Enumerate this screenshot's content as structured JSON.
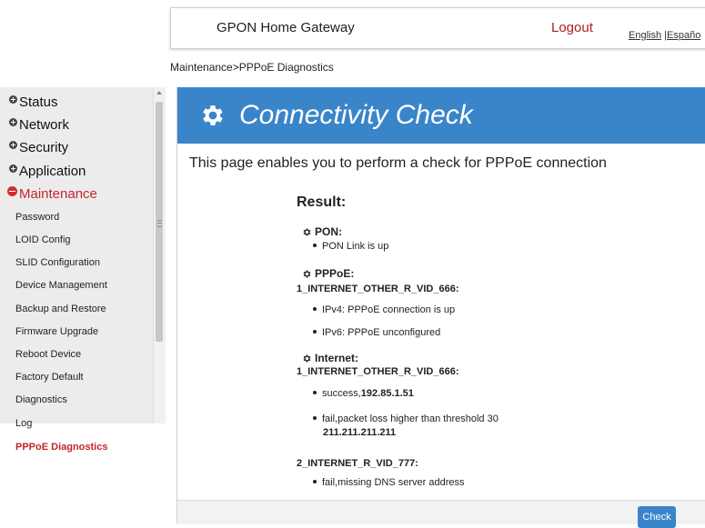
{
  "header": {
    "title": "GPON Home Gateway",
    "logout": "Logout",
    "lang_english": "English",
    "lang_sep": " |",
    "lang_spanish": "Españo"
  },
  "breadcrumb": "Maintenance>PPPoE Diagnostics",
  "sidebar": {
    "top": [
      {
        "label": "Status"
      },
      {
        "label": "Network"
      },
      {
        "label": "Security"
      },
      {
        "label": "Application"
      },
      {
        "label": "Maintenance"
      }
    ],
    "maintenance_items": [
      "Password",
      "LOID Config",
      "SLID Configuration",
      "Device Management",
      "Backup and Restore",
      "Firmware Upgrade",
      "Reboot Device",
      "Factory Default",
      "Diagnostics",
      "Log",
      "PPPoE Diagnostics"
    ],
    "selected": "PPPoE Diagnostics"
  },
  "panel": {
    "title": "Connectivity Check",
    "intro": "This page enables you to perform a check for PPPoE connection",
    "result_heading": "Result:",
    "pon": {
      "heading": "PON:",
      "items": [
        "PON Link is up"
      ]
    },
    "pppoe": {
      "heading": "PPPoE:",
      "iface": "1_INTERNET_OTHER_R_VID_666:",
      "items": [
        "IPv4: PPPoE connection is up",
        "IPv6: PPPoE unconfigured"
      ]
    },
    "internet": {
      "heading": "Internet:",
      "iface1": "1_INTERNET_OTHER_R_VID_666:",
      "success_prefix": "success,",
      "success_ip": "192.85.1.51",
      "fail_text": "fail,packet loss higher than threshold 30",
      "fail_ip": "211.211.211.211",
      "iface2": "2_INTERNET_R_VID_777:",
      "fail_dns": "fail,missing DNS server address"
    },
    "check_button": "Check"
  },
  "colors": {
    "header_blue": "#3a85c9",
    "active_red": "#c4262d",
    "logout_red": "#b41d1d"
  },
  "icons": [
    "gear-icon",
    "plus-bullet-icon",
    "minus-bullet-icon",
    "scroll-up-arrow-icon"
  ]
}
